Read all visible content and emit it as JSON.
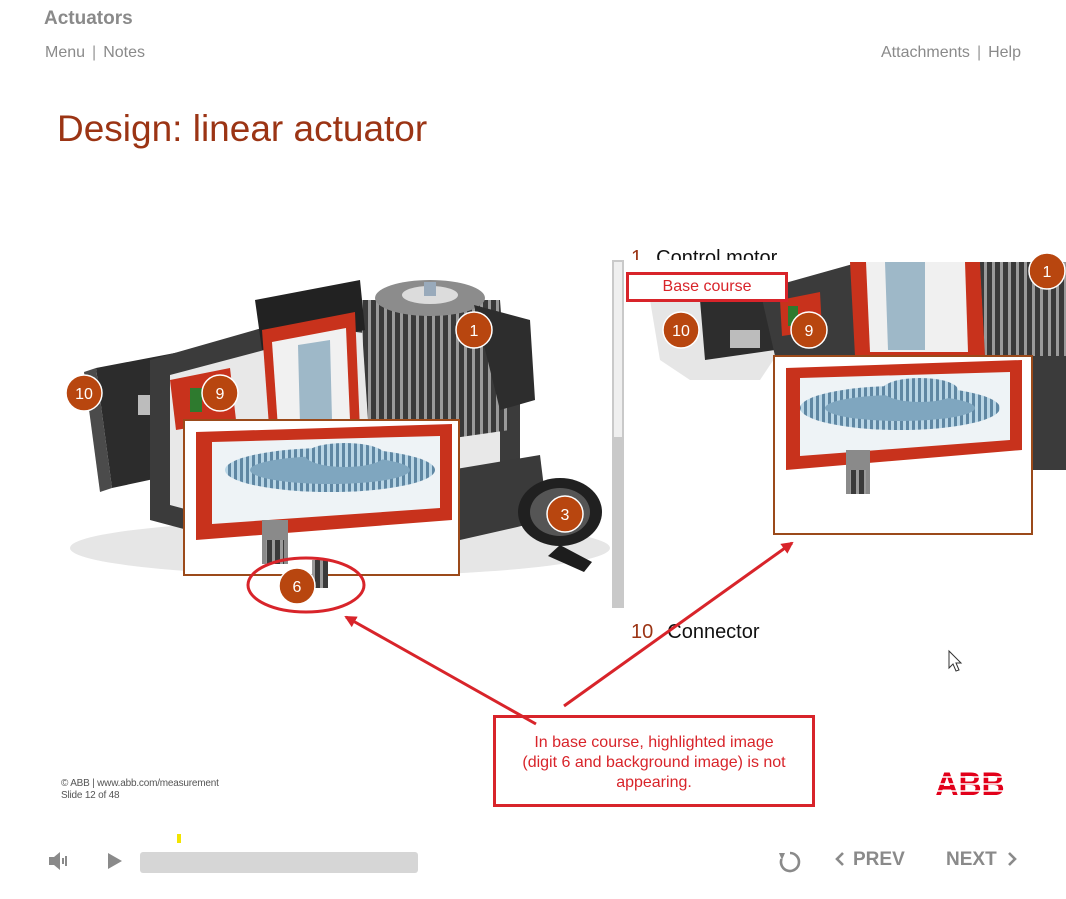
{
  "header": {
    "course_title": "Actuators",
    "nav_left": [
      "Menu",
      "Notes"
    ],
    "nav_right": [
      "Attachments",
      "Help"
    ]
  },
  "slide": {
    "title": "Design: linear actuator",
    "callouts_left": [
      "1",
      "3",
      "6",
      "9",
      "10"
    ],
    "callouts_right": [
      "1",
      "9",
      "10"
    ],
    "list_top": {
      "num": "1",
      "label": "Control motor"
    },
    "list_bottom": {
      "num": "10",
      "label": "Connector"
    }
  },
  "annotations": {
    "base_course_label": "Base course",
    "issue_note_lines": [
      "In base course, highlighted image",
      "(digit 6 and background image) is not",
      "appearing."
    ]
  },
  "footer": {
    "copyright": "© ABB | www.abb.com/measurement",
    "slide_counter": "Slide 12 of 48",
    "logo_text": "ABB"
  },
  "player": {
    "prev_label": "PREV",
    "next_label": "NEXT",
    "progress": 0.14
  },
  "colors": {
    "accent": "#9b3414",
    "annotation": "#d8242a",
    "callout": "#b8460f",
    "abb_red": "#e2001a"
  }
}
